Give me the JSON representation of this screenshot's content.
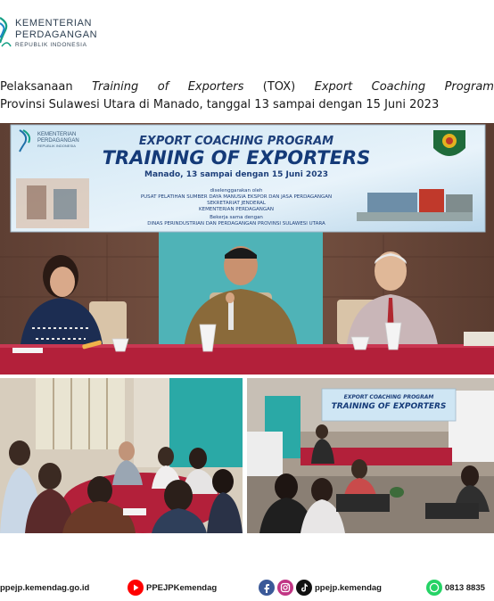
{
  "brand": {
    "line1": "KEMENTERIAN",
    "line2": "PERDAGANGAN",
    "line3": "REPUBLIK INDONESIA"
  },
  "caption": {
    "w1": "Pelaksanaan",
    "w2": "Training",
    "w3": "of",
    "w4": "Exporters",
    "w5": "(TOX)",
    "w6": "Export",
    "w7": "Coaching",
    "w8": "Program",
    "line2": "Provinsi Sulawesi Utara di Manado, tanggal 13 sampai dengan 15 Juni 2023"
  },
  "banner": {
    "title1": "EXPORT COACHING PROGRAM",
    "title2": "TRAINING OF EXPORTERS",
    "date": "Manado, 13 sampai dengan 15 Juni 2023",
    "org0": "diselenggarakan oleh",
    "org1": "PUSAT PELATIHAN SUMBER DAYA MANUSIA EKSPOR DAN JASA PERDAGANGAN",
    "org2": "SEKRETARIAT JENDERAL",
    "org3": "KEMENTERIAN PERDAGANGAN",
    "org4": "Bekerja sama dengan",
    "org5": "DINAS PERINDUSTRIAN DAN PERDAGANGAN PROVINSI SULAWESI UTARA",
    "logo_line1": "KEMENTERIAN",
    "logo_line2": "PERDAGANGAN",
    "logo_line3": "REPUBLIK INDONESIA"
  },
  "banner_small": {
    "title1": "EXPORT COACHING PROGRAM",
    "title2": "TRAINING OF EXPORTERS"
  },
  "footer": {
    "website": "ppejp.kemendag.go.id",
    "youtube": "PPEJPKemendag",
    "social": "ppejp.kemendag",
    "whatsapp": "0813 8835"
  },
  "colors": {
    "brand_teal": "#16a085",
    "table_red": "#b3203a",
    "wall_teal": "#4fb3b7",
    "youtube_red": "#ff0000",
    "facebook_blue": "#3b5998",
    "whatsapp_green": "#25d366"
  },
  "icons": [
    "kemendag-logo-icon",
    "youtube-icon",
    "facebook-icon",
    "instagram-icon",
    "tiktok-icon",
    "whatsapp-icon"
  ]
}
